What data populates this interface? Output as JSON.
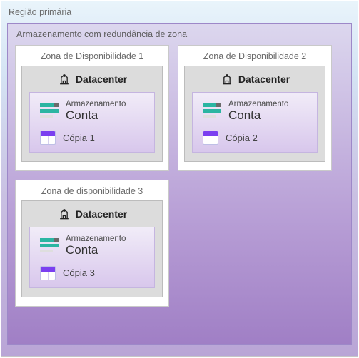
{
  "region_title": "Região primária",
  "zrs_title": "Armazenamento com redundância de zona",
  "datacenter_label": "Datacenter",
  "storage_label_small": "Armazenamento",
  "storage_label_large": "Conta",
  "zones": [
    {
      "title": "Zona de Disponibilidade 1",
      "copy_label": "Cópia 1"
    },
    {
      "title": "Zona de Disponibilidade 2",
      "copy_label": "Cópia 2"
    },
    {
      "title": "Zona de disponibilidade 3",
      "copy_label": "Cópia 3"
    }
  ],
  "colors": {
    "accent_teal": "#2bb5a2",
    "accent_purple": "#7b3ff0"
  }
}
